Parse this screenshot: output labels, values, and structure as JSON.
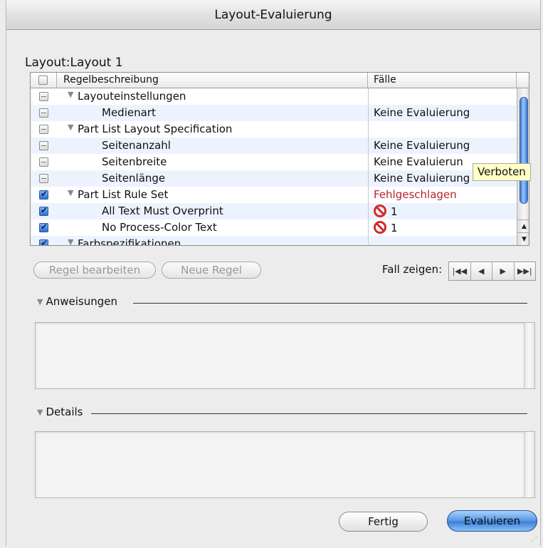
{
  "window": {
    "title": "Layout-Evaluierung"
  },
  "layout_label": "Layout:Layout 1",
  "table": {
    "headers": {
      "description": "Regelbeschreibung",
      "cases": "Fälle"
    },
    "rows": [
      {
        "label": "Layouteinstellungen",
        "expander": true,
        "indent": 0,
        "check": "mixed",
        "count": ""
      },
      {
        "label": "Medienart",
        "expander": false,
        "indent": 1,
        "check": "mixed",
        "count": "Keine Evaluierung"
      },
      {
        "label": "Part List Layout Specification",
        "expander": true,
        "indent": 0,
        "check": "mixed",
        "count": ""
      },
      {
        "label": "Seitenanzahl",
        "expander": false,
        "indent": 1,
        "check": "mixed",
        "count": "Keine Evaluierung"
      },
      {
        "label": "Seitenbreite",
        "expander": false,
        "indent": 1,
        "check": "mixed",
        "count": "Keine Evaluierun"
      },
      {
        "label": "Seitenlänge",
        "expander": false,
        "indent": 1,
        "check": "mixed",
        "count": "Keine Evaluierung"
      },
      {
        "label": "Part List Rule Set",
        "expander": true,
        "indent": 0,
        "check": "checked",
        "count": "Fehlgeschlagen",
        "status": "fail"
      },
      {
        "label": "All Text Must Overprint",
        "expander": false,
        "indent": 1,
        "check": "checked",
        "count": "1",
        "icon": "prohibited-icon"
      },
      {
        "label": "No Process-Color Text",
        "expander": false,
        "indent": 1,
        "check": "checked",
        "count": "1",
        "icon": "prohibited-icon"
      },
      {
        "label": "Farbspezifikationen",
        "expander": true,
        "indent": 0,
        "check": "checked",
        "count": ""
      }
    ],
    "tooltip": "Verboten"
  },
  "buttons": {
    "edit_rule": "Regel bearbeiten",
    "new_rule": "Neue Regel",
    "show_case": "Fall zeigen:",
    "done": "Fertig",
    "evaluate": "Evaluieren"
  },
  "nav_icons": [
    "first-icon",
    "previous-icon",
    "next-icon",
    "last-icon"
  ],
  "sections": {
    "instructions": "Anweisungen",
    "details": "Details"
  },
  "colors": {
    "fail": "#b3252d",
    "accent": "#3c7fd8",
    "row_alt": "#edf3fe"
  }
}
